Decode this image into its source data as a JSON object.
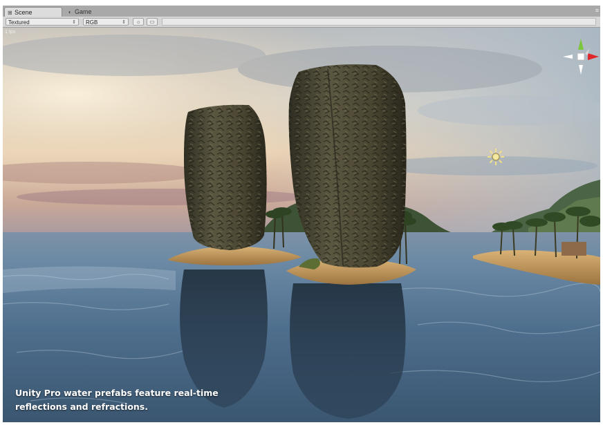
{
  "tabs": [
    {
      "label": "Scene",
      "icon": "scene-grid-icon",
      "active": true
    },
    {
      "label": "Game",
      "icon": "game-pacman-icon",
      "active": false
    }
  ],
  "window_control": "≡",
  "toolbar": {
    "draw_mode": "Textured",
    "render_channel": "RGB",
    "light_icon": "sun-toggle-icon",
    "image_icon": "image-toggle-icon"
  },
  "viewport": {
    "fps_label": "1 fps",
    "gizmo": "orientation-gizmo-icon",
    "light_gizmo": "directional-light-icon"
  },
  "caption": {
    "line1": "Unity Pro water prefabs feature real-time",
    "line2": "reflections and refractions."
  },
  "colors": {
    "sky_top": "#c8ccd0",
    "sky_warm": "#f2e2c6",
    "water": "#4f6f8c",
    "rock": "#4a4632",
    "sand": "#c79a5c",
    "caption_text": "#ffffff",
    "gizmo_x": "#e0262a",
    "gizmo_y": "#7cc63c"
  }
}
